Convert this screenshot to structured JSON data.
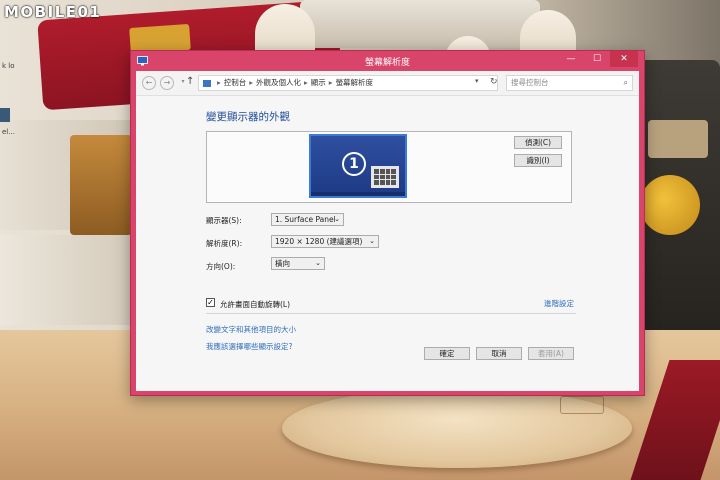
{
  "watermark": "MOBILE01",
  "desktop": {
    "label1": "k lo",
    "label2": "el..."
  },
  "window": {
    "title": "螢幕解析度",
    "controls": {
      "minimize": "—",
      "maximize": "☐",
      "close": "✕"
    }
  },
  "addressbar": {
    "breadcrumbs": [
      "控制台",
      "外觀及個人化",
      "顯示",
      "螢幕解析度"
    ],
    "search_placeholder": "搜尋控制台"
  },
  "main": {
    "heading": "變更顯示器的外觀",
    "monitor_number": "1",
    "detect_label": "偵測(C)",
    "identify_label": "識別(I)",
    "display_label": "顯示器(S):",
    "display_value": "1. Surface Panel",
    "resolution_label": "解析度(R):",
    "resolution_value": "1920 × 1280 (建議選項)",
    "orientation_label": "方向(O):",
    "orientation_value": "橫向",
    "auto_rotate_label": "允許畫面自動旋轉(L)",
    "auto_rotate_checked": true,
    "advanced_link": "進階設定",
    "link_text_size": "改變文字和其他項目的大小",
    "link_help": "我應該選擇哪些顯示設定?"
  },
  "footer": {
    "ok_label": "確定",
    "cancel_label": "取消",
    "apply_label": "套用(A)"
  },
  "colors": {
    "window_frame": "#d9446a",
    "heading": "#1f4e9c",
    "link": "#2f6fbf",
    "monitor_fill": "#2e4f9f"
  }
}
